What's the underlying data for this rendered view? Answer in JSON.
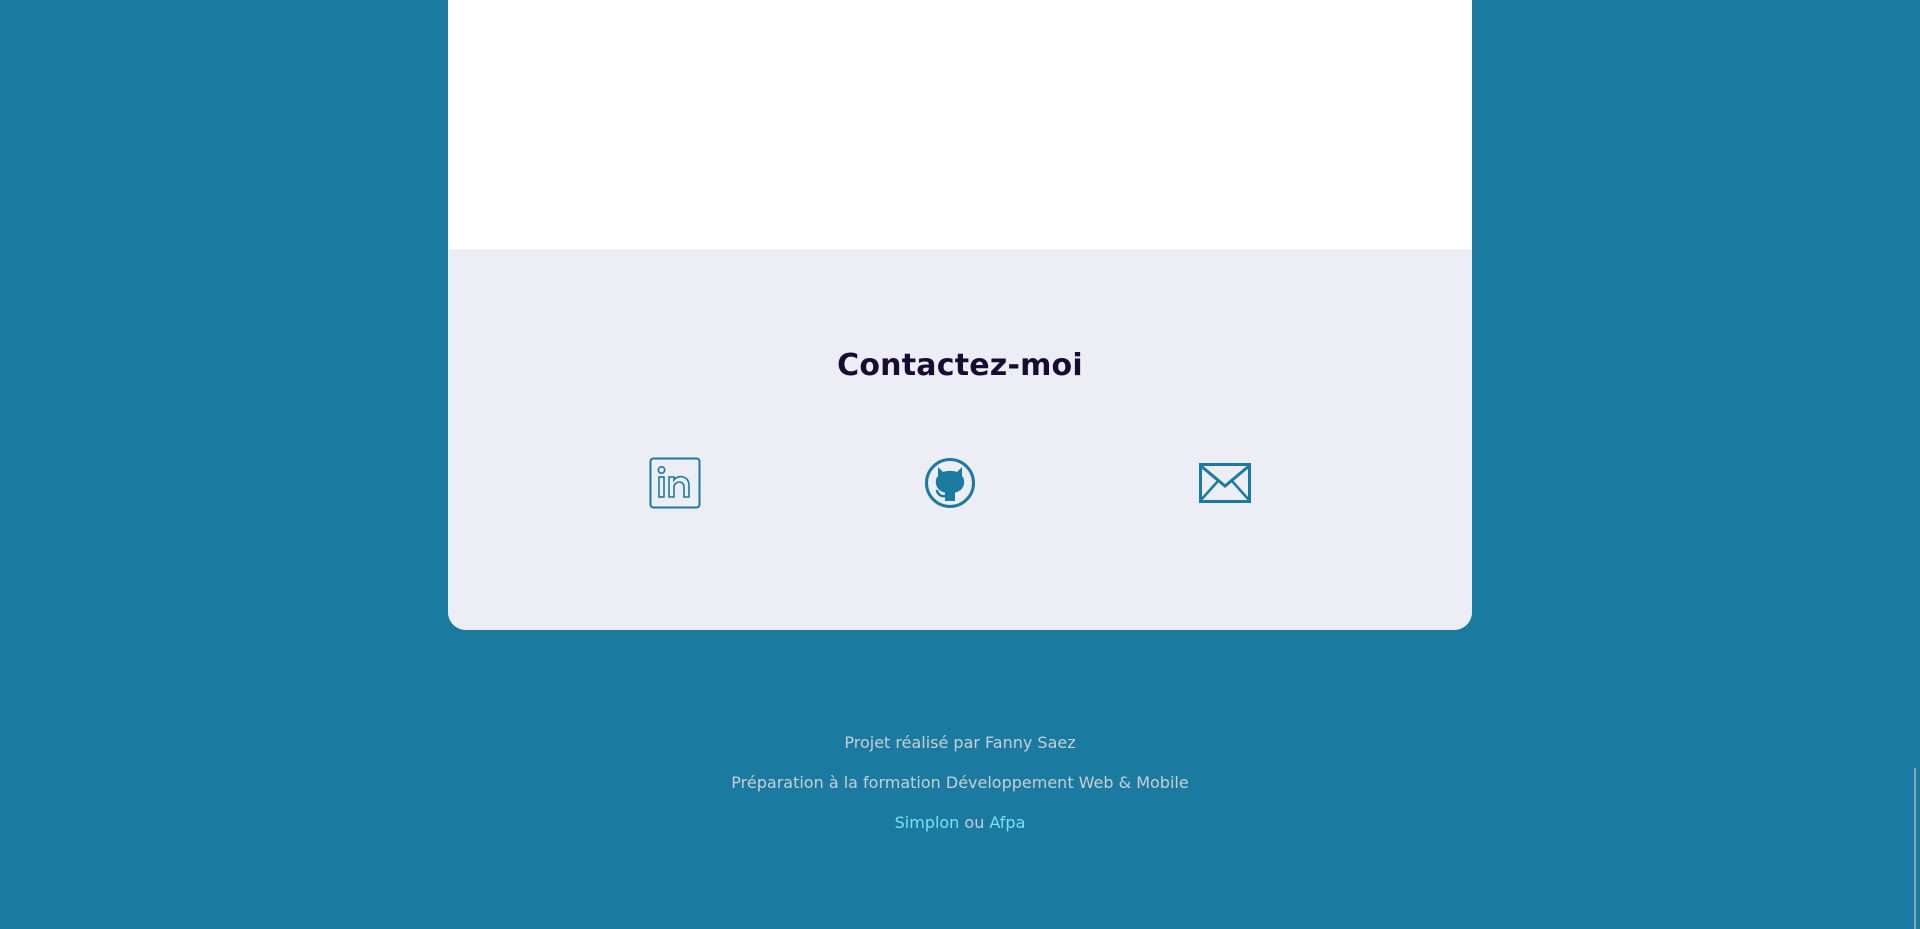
{
  "contact": {
    "title": "Contactez-moi",
    "links": [
      {
        "name": "LinkedIn",
        "icon": "linkedin-icon"
      },
      {
        "name": "GitHub",
        "icon": "github-icon"
      },
      {
        "name": "Email",
        "icon": "envelope-icon"
      }
    ]
  },
  "footer": {
    "credit": "Projet réalisé par Fanny Saez",
    "training": "Préparation à la formation Développement Web & Mobile",
    "link_simplon": "Simplon",
    "separator": "ou",
    "link_afpa": "Afpa"
  },
  "colors": {
    "background": "#1b7aa0",
    "card": "#ffffff",
    "contact_bg": "#ededf5",
    "title": "#180c32",
    "icon": "#1b7aa0",
    "footer_text": "#c7cfd6",
    "footer_link": "#7ee0f0"
  }
}
